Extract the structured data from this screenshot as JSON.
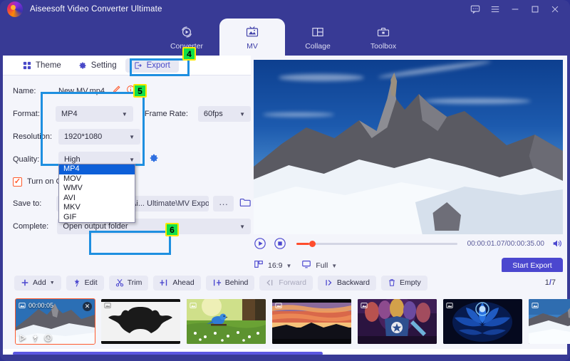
{
  "window": {
    "title": "Aiseesoft Video Converter Ultimate",
    "controls": [
      {
        "name": "feedback-icon",
        "glyph": "feedback"
      },
      {
        "name": "menu-icon",
        "glyph": "hamburger"
      },
      {
        "name": "minimize-icon",
        "glyph": "minimize"
      },
      {
        "name": "maximize-icon",
        "glyph": "maximize"
      },
      {
        "name": "close-icon",
        "glyph": "close"
      }
    ]
  },
  "topnav": {
    "items": [
      {
        "label": "Converter",
        "icon": "converter-icon",
        "active": false
      },
      {
        "label": "MV",
        "icon": "mv-icon",
        "active": true
      },
      {
        "label": "Collage",
        "icon": "collage-icon",
        "active": false
      },
      {
        "label": "Toolbox",
        "icon": "toolbox-icon",
        "active": false
      }
    ]
  },
  "subtabs": {
    "theme": "Theme",
    "setting": "Setting",
    "export": "Export"
  },
  "form": {
    "name_label": "Name:",
    "name_value": "New MV.mp4",
    "format_label": "Format:",
    "format_value": "MP4",
    "framerate_label": "Frame Rate:",
    "framerate_value": "60fps",
    "resolution_label": "Resolution:",
    "resolution_value": "1920*1080",
    "quality_label": "Quality:",
    "quality_value": "High",
    "gpu_label": "Turn on GPU Acceleration",
    "saveto_label": "Save to:",
    "saveto_value": "C:\\Aiseesoft Studio\\Ai... Ultimate\\MV Exported",
    "dots_label": "···",
    "complete_label": "Complete:",
    "complete_value": "Open output folder",
    "start_export": "Start Export"
  },
  "format_dropdown": {
    "open": true,
    "options": [
      "MP4",
      "MOV",
      "WMV",
      "AVI",
      "MKV",
      "GIF"
    ],
    "selected": "MP4"
  },
  "badges": [
    {
      "label": "4",
      "for": "export-tab"
    },
    {
      "label": "5",
      "for": "format-dropdown"
    },
    {
      "label": "6",
      "for": "start-export-button"
    }
  ],
  "player": {
    "play_icon": "play-icon",
    "stop_icon": "stop-icon",
    "timecode": "00:00:01.07/00:00:35.00",
    "current_time": "00:00:01.07",
    "total_time": "00:00:35.00",
    "progress_percent": 8,
    "volume_icon": "volume-icon",
    "aspect_label": "16:9",
    "screen_label": "Full",
    "start_export": "Start Export"
  },
  "toolbar": {
    "buttons": [
      {
        "label": "Add",
        "icon": "plus-icon",
        "has_caret": true,
        "disabled": false
      },
      {
        "label": "Edit",
        "icon": "magic-wand-icon",
        "has_caret": false,
        "disabled": false
      },
      {
        "label": "Trim",
        "icon": "scissors-icon",
        "has_caret": false,
        "disabled": false
      },
      {
        "label": "Ahead",
        "icon": "insert-ahead-icon",
        "has_caret": false,
        "disabled": false
      },
      {
        "label": "Behind",
        "icon": "insert-behind-icon",
        "has_caret": false,
        "disabled": false
      },
      {
        "label": "Forward",
        "icon": "move-forward-icon",
        "has_caret": false,
        "disabled": true
      },
      {
        "label": "Backward",
        "icon": "move-backward-icon",
        "has_caret": false,
        "disabled": false
      },
      {
        "label": "Empty",
        "icon": "trash-icon",
        "has_caret": false,
        "disabled": false
      }
    ],
    "page_current": "1",
    "page_separator": "/",
    "page_total": "7"
  },
  "thumbnails": [
    {
      "name": "clip-mountain-peak",
      "duration": "00:00:05",
      "active": true,
      "art": "mountain",
      "show_tools": true
    },
    {
      "name": "clip-batman-logo",
      "duration": "",
      "active": false,
      "art": "batman",
      "show_tools": false
    },
    {
      "name": "clip-bluebird-meadow",
      "duration": "",
      "active": false,
      "art": "bird",
      "show_tools": false
    },
    {
      "name": "clip-sunset-canyon",
      "duration": "",
      "active": false,
      "art": "sunset",
      "show_tools": false
    },
    {
      "name": "clip-avengers-poster",
      "duration": "",
      "active": false,
      "art": "avengers",
      "show_tools": false
    },
    {
      "name": "clip-blue-lotus",
      "duration": "",
      "active": false,
      "art": "lotus",
      "show_tools": false
    },
    {
      "name": "clip-snow-ridge",
      "duration": "",
      "active": false,
      "art": "snowridge",
      "show_tools": false
    }
  ],
  "colors": {
    "brand_purple": "#383a95",
    "accent_blue": "#4b47cf",
    "highlight_blue": "#1e8fe0",
    "badge_green": "#12e04a",
    "badge_border_yellow": "#ffe800",
    "active_orange": "#ff5a2d",
    "panel_bg": "#f4f5fb"
  }
}
